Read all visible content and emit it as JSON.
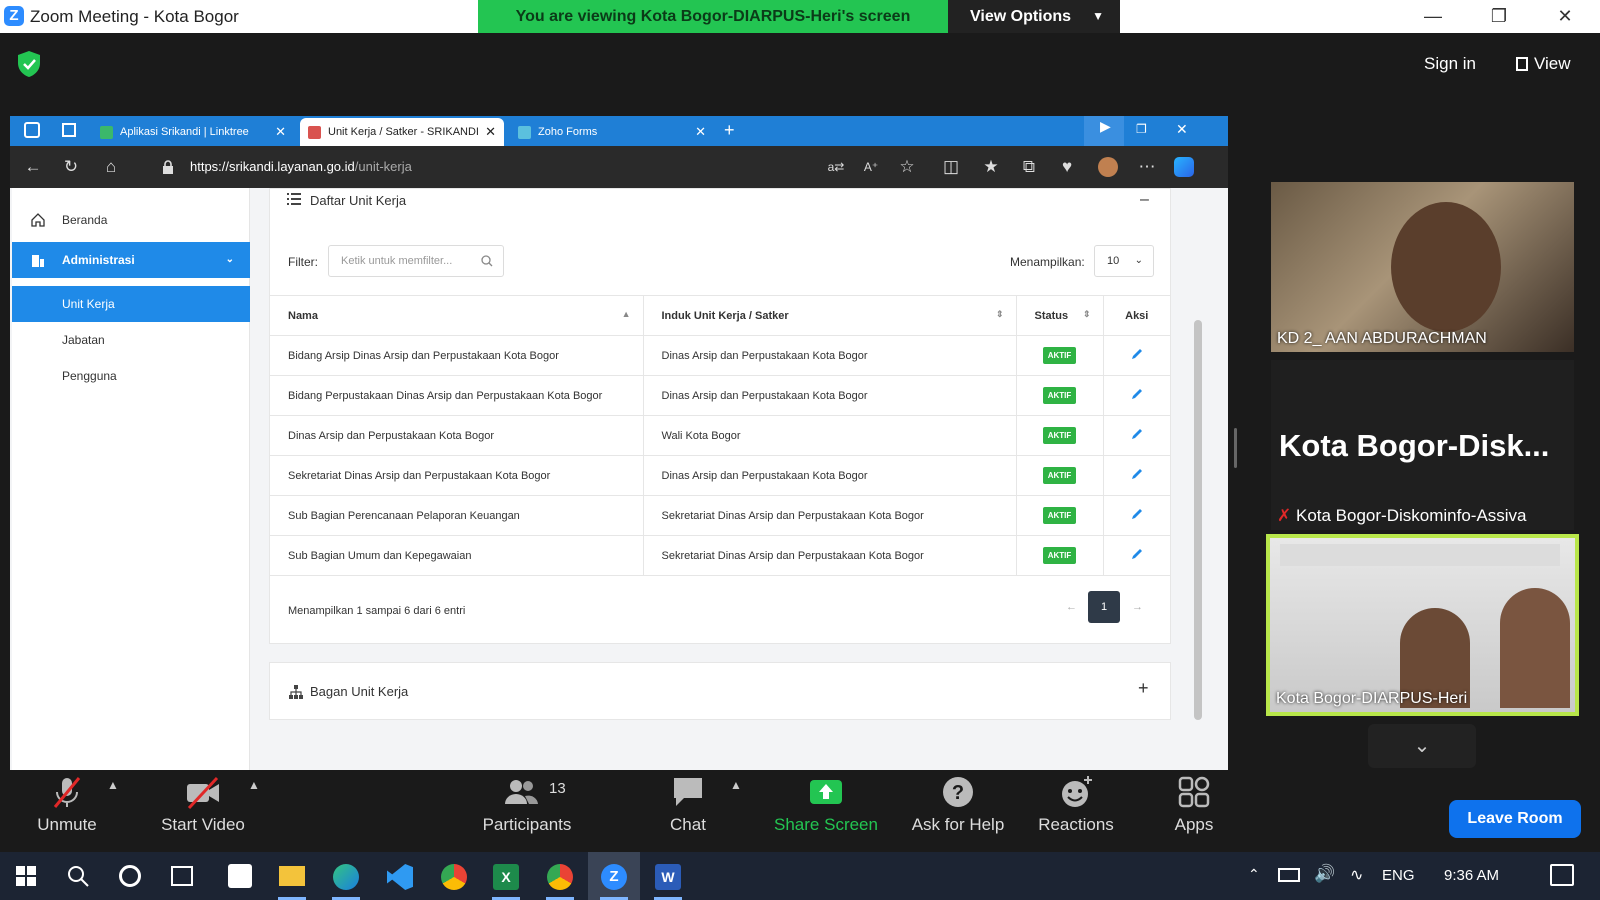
{
  "zoom": {
    "window_title": "Zoom Meeting - Kota Bogor",
    "banner_text": "You are viewing Kota Bogor-DIARPUS-Heri's screen",
    "view_options_label": "View Options",
    "sign_in_label": "Sign in",
    "view_label": "View"
  },
  "browser": {
    "tabs": [
      {
        "label": "Aplikasi Srikandi | Linktree",
        "active": false
      },
      {
        "label": "Unit Kerja / Satker - SRIKANDI",
        "active": true
      },
      {
        "label": "Zoho Forms",
        "active": false
      }
    ],
    "url_host": "https://srikandi.layanan.go.id",
    "url_path": "/unit-kerja"
  },
  "sidebar": {
    "items": [
      {
        "label": "Beranda"
      },
      {
        "label": "Administrasi"
      },
      {
        "label": "Unit Kerja"
      },
      {
        "label": "Jabatan"
      },
      {
        "label": "Pengguna"
      }
    ]
  },
  "main": {
    "card_title": "Daftar Unit Kerja",
    "filter_label": "Filter:",
    "filter_placeholder": "Ketik untuk memfilter...",
    "show_label": "Menampilkan:",
    "show_value": "10",
    "columns": [
      "Nama",
      "Induk Unit Kerja / Satker",
      "Status",
      "Aksi"
    ],
    "rows": [
      {
        "nama": "Bidang Arsip Dinas Arsip dan Perpustakaan Kota Bogor",
        "induk": "Dinas Arsip dan Perpustakaan Kota Bogor",
        "status": "AKTIF"
      },
      {
        "nama": "Bidang Perpustakaan Dinas Arsip dan Perpustakaan Kota Bogor",
        "induk": "Dinas Arsip dan Perpustakaan Kota Bogor",
        "status": "AKTIF"
      },
      {
        "nama": "Dinas Arsip dan Perpustakaan Kota Bogor",
        "induk": "Wali Kota Bogor",
        "status": "AKTIF"
      },
      {
        "nama": "Sekretariat Dinas Arsip dan Perpustakaan Kota Bogor",
        "induk": "Dinas Arsip dan Perpustakaan Kota Bogor",
        "status": "AKTIF"
      },
      {
        "nama": "Sub Bagian Perencanaan Pelaporan Keuangan",
        "induk": "Sekretariat Dinas Arsip dan Perpustakaan Kota Bogor",
        "status": "AKTIF"
      },
      {
        "nama": "Sub Bagian Umum dan Kepegawaian",
        "induk": "Sekretariat Dinas Arsip dan Perpustakaan Kota Bogor",
        "status": "AKTIF"
      }
    ],
    "entries_text": "Menampilkan 1 sampai 6 dari 6 entri",
    "page_current": "1",
    "bagan_title": "Bagan Unit Kerja"
  },
  "participants_panel": {
    "videos": [
      {
        "name": "KD 2_ AAN ABDURACHMAN"
      },
      {
        "name": "Kota  Bogor-Disk...",
        "sub": "Kota Bogor-Diskominfo-Assiva"
      },
      {
        "name": "Kota Bogor-DIARPUS-Heri"
      }
    ]
  },
  "toolbar": {
    "unmute": "Unmute",
    "start_video": "Start Video",
    "participants": "Participants",
    "participants_count": "13",
    "chat": "Chat",
    "share_screen": "Share Screen",
    "ask_help": "Ask for Help",
    "reactions": "Reactions",
    "apps": "Apps",
    "leave": "Leave Room"
  },
  "taskbar": {
    "lang": "ENG",
    "time": "9:36 AM"
  },
  "colors": {
    "banner": "#23c552",
    "accent": "#1f8ae8",
    "badge": "#2fb344",
    "leave": "#0e72ed"
  }
}
